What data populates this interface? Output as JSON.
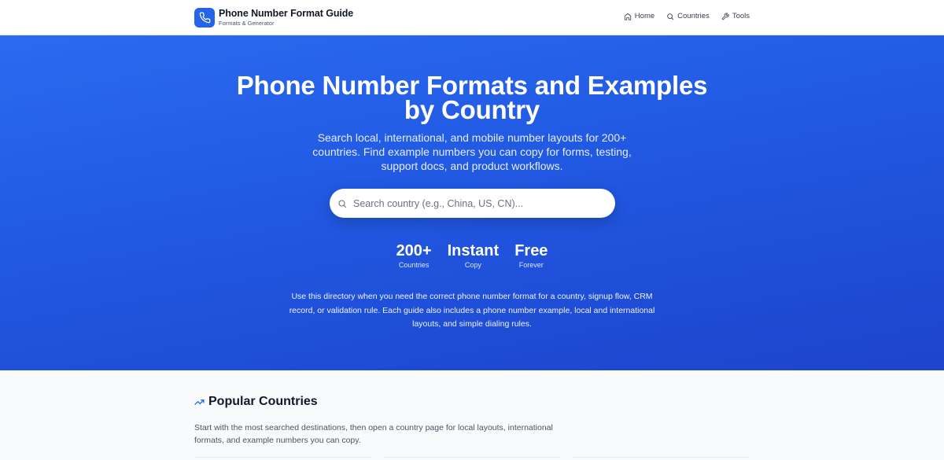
{
  "header": {
    "brand_title": "Phone Number Format Guide",
    "brand_subtitle": "Formats & Generator",
    "nav": [
      {
        "label": "Home",
        "icon": "home-icon"
      },
      {
        "label": "Countries",
        "icon": "search-icon"
      },
      {
        "label": "Tools",
        "icon": "wrench-icon"
      }
    ]
  },
  "hero": {
    "title_line1": "Phone Number Formats and Examples",
    "title_line2": "by Country",
    "subtitle": "Search local, international, and mobile number layouts for 200+ countries. Find example numbers you can copy for forms, testing, support docs, and product workflows.",
    "search_placeholder": "Search country (e.g., China, US, CN)...",
    "stats": [
      {
        "value": "200+",
        "label": "Countries"
      },
      {
        "value": "Instant",
        "label": "Copy"
      },
      {
        "value": "Free",
        "label": "Forever"
      }
    ],
    "description": "Use this directory when you need the correct phone number format for a country, signup flow, CRM record, or validation rule. Each guide also includes a phone number example, local and international layouts, and simple dialing rules."
  },
  "popular": {
    "title": "Popular Countries",
    "icon": "trending-up-icon",
    "description": "Start with the most searched destinations, then open a country page for local layouts, international formats, and example numbers you can copy."
  },
  "colors": {
    "accent": "#2563eb",
    "hero_start": "#2a6bf0",
    "hero_end": "#1d44cc"
  }
}
